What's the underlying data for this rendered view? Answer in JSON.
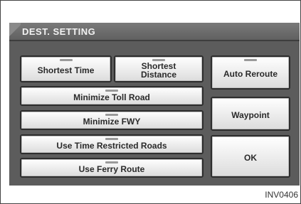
{
  "header": {
    "title": "DEST. SETTING"
  },
  "buttons": {
    "shortest_time": "Shortest Time",
    "shortest_distance_line1": "Shortest",
    "shortest_distance_line2": "Distance",
    "minimize_toll_road": "Minimize Toll Road",
    "minimize_fwy": "Minimize FWY",
    "use_time_restricted_roads": "Use Time Restricted Roads",
    "use_ferry_route": "Use Ferry Route",
    "auto_reroute": "Auto Reroute",
    "waypoint": "Waypoint",
    "ok": "OK"
  },
  "image_id": "INV0406"
}
